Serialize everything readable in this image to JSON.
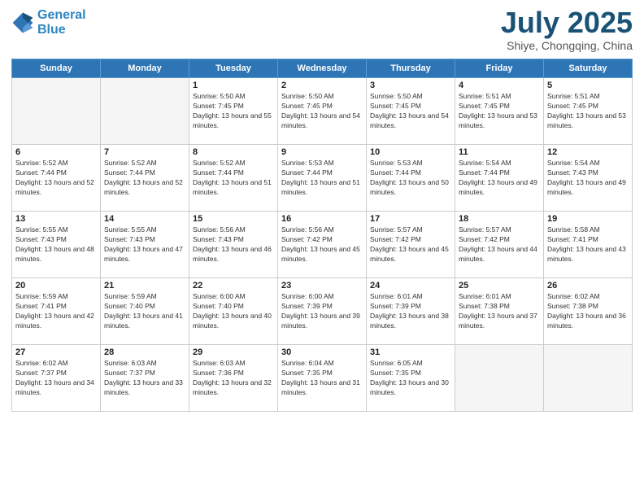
{
  "header": {
    "logo_line1": "General",
    "logo_line2": "Blue",
    "month": "July 2025",
    "location": "Shiye, Chongqing, China"
  },
  "weekdays": [
    "Sunday",
    "Monday",
    "Tuesday",
    "Wednesday",
    "Thursday",
    "Friday",
    "Saturday"
  ],
  "weeks": [
    [
      {
        "day": "",
        "info": ""
      },
      {
        "day": "",
        "info": ""
      },
      {
        "day": "1",
        "sunrise": "5:50 AM",
        "sunset": "7:45 PM",
        "daylight": "13 hours and 55 minutes."
      },
      {
        "day": "2",
        "sunrise": "5:50 AM",
        "sunset": "7:45 PM",
        "daylight": "13 hours and 54 minutes."
      },
      {
        "day": "3",
        "sunrise": "5:50 AM",
        "sunset": "7:45 PM",
        "daylight": "13 hours and 54 minutes."
      },
      {
        "day": "4",
        "sunrise": "5:51 AM",
        "sunset": "7:45 PM",
        "daylight": "13 hours and 53 minutes."
      },
      {
        "day": "5",
        "sunrise": "5:51 AM",
        "sunset": "7:45 PM",
        "daylight": "13 hours and 53 minutes."
      }
    ],
    [
      {
        "day": "6",
        "sunrise": "5:52 AM",
        "sunset": "7:44 PM",
        "daylight": "13 hours and 52 minutes."
      },
      {
        "day": "7",
        "sunrise": "5:52 AM",
        "sunset": "7:44 PM",
        "daylight": "13 hours and 52 minutes."
      },
      {
        "day": "8",
        "sunrise": "5:52 AM",
        "sunset": "7:44 PM",
        "daylight": "13 hours and 51 minutes."
      },
      {
        "day": "9",
        "sunrise": "5:53 AM",
        "sunset": "7:44 PM",
        "daylight": "13 hours and 51 minutes."
      },
      {
        "day": "10",
        "sunrise": "5:53 AM",
        "sunset": "7:44 PM",
        "daylight": "13 hours and 50 minutes."
      },
      {
        "day": "11",
        "sunrise": "5:54 AM",
        "sunset": "7:44 PM",
        "daylight": "13 hours and 49 minutes."
      },
      {
        "day": "12",
        "sunrise": "5:54 AM",
        "sunset": "7:43 PM",
        "daylight": "13 hours and 49 minutes."
      }
    ],
    [
      {
        "day": "13",
        "sunrise": "5:55 AM",
        "sunset": "7:43 PM",
        "daylight": "13 hours and 48 minutes."
      },
      {
        "day": "14",
        "sunrise": "5:55 AM",
        "sunset": "7:43 PM",
        "daylight": "13 hours and 47 minutes."
      },
      {
        "day": "15",
        "sunrise": "5:56 AM",
        "sunset": "7:43 PM",
        "daylight": "13 hours and 46 minutes."
      },
      {
        "day": "16",
        "sunrise": "5:56 AM",
        "sunset": "7:42 PM",
        "daylight": "13 hours and 45 minutes."
      },
      {
        "day": "17",
        "sunrise": "5:57 AM",
        "sunset": "7:42 PM",
        "daylight": "13 hours and 45 minutes."
      },
      {
        "day": "18",
        "sunrise": "5:57 AM",
        "sunset": "7:42 PM",
        "daylight": "13 hours and 44 minutes."
      },
      {
        "day": "19",
        "sunrise": "5:58 AM",
        "sunset": "7:41 PM",
        "daylight": "13 hours and 43 minutes."
      }
    ],
    [
      {
        "day": "20",
        "sunrise": "5:59 AM",
        "sunset": "7:41 PM",
        "daylight": "13 hours and 42 minutes."
      },
      {
        "day": "21",
        "sunrise": "5:59 AM",
        "sunset": "7:40 PM",
        "daylight": "13 hours and 41 minutes."
      },
      {
        "day": "22",
        "sunrise": "6:00 AM",
        "sunset": "7:40 PM",
        "daylight": "13 hours and 40 minutes."
      },
      {
        "day": "23",
        "sunrise": "6:00 AM",
        "sunset": "7:39 PM",
        "daylight": "13 hours and 39 minutes."
      },
      {
        "day": "24",
        "sunrise": "6:01 AM",
        "sunset": "7:39 PM",
        "daylight": "13 hours and 38 minutes."
      },
      {
        "day": "25",
        "sunrise": "6:01 AM",
        "sunset": "7:38 PM",
        "daylight": "13 hours and 37 minutes."
      },
      {
        "day": "26",
        "sunrise": "6:02 AM",
        "sunset": "7:38 PM",
        "daylight": "13 hours and 36 minutes."
      }
    ],
    [
      {
        "day": "27",
        "sunrise": "6:02 AM",
        "sunset": "7:37 PM",
        "daylight": "13 hours and 34 minutes."
      },
      {
        "day": "28",
        "sunrise": "6:03 AM",
        "sunset": "7:37 PM",
        "daylight": "13 hours and 33 minutes."
      },
      {
        "day": "29",
        "sunrise": "6:03 AM",
        "sunset": "7:36 PM",
        "daylight": "13 hours and 32 minutes."
      },
      {
        "day": "30",
        "sunrise": "6:04 AM",
        "sunset": "7:35 PM",
        "daylight": "13 hours and 31 minutes."
      },
      {
        "day": "31",
        "sunrise": "6:05 AM",
        "sunset": "7:35 PM",
        "daylight": "13 hours and 30 minutes."
      },
      {
        "day": "",
        "info": ""
      },
      {
        "day": "",
        "info": ""
      }
    ]
  ]
}
